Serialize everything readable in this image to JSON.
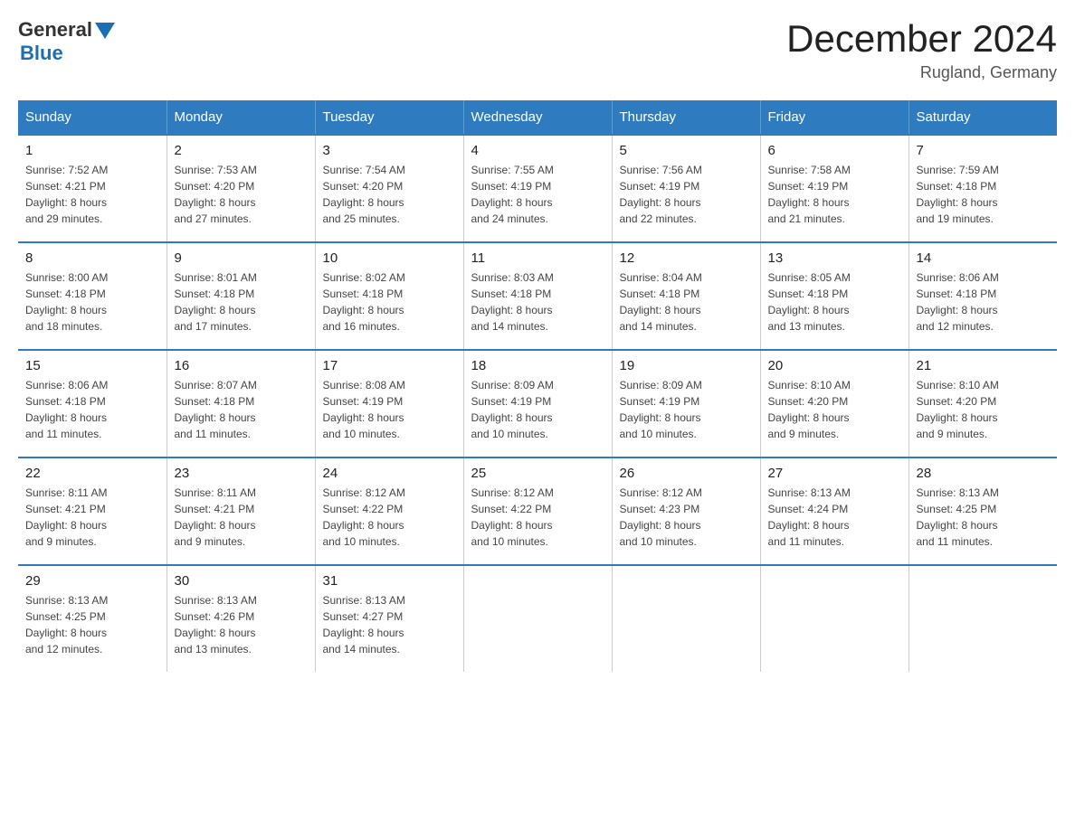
{
  "logo": {
    "general": "General",
    "blue": "Blue"
  },
  "title": "December 2024",
  "location": "Rugland, Germany",
  "days_of_week": [
    "Sunday",
    "Monday",
    "Tuesday",
    "Wednesday",
    "Thursday",
    "Friday",
    "Saturday"
  ],
  "weeks": [
    [
      {
        "day": "1",
        "sunrise": "7:52 AM",
        "sunset": "4:21 PM",
        "daylight": "8 hours and 29 minutes."
      },
      {
        "day": "2",
        "sunrise": "7:53 AM",
        "sunset": "4:20 PM",
        "daylight": "8 hours and 27 minutes."
      },
      {
        "day": "3",
        "sunrise": "7:54 AM",
        "sunset": "4:20 PM",
        "daylight": "8 hours and 25 minutes."
      },
      {
        "day": "4",
        "sunrise": "7:55 AM",
        "sunset": "4:19 PM",
        "daylight": "8 hours and 24 minutes."
      },
      {
        "day": "5",
        "sunrise": "7:56 AM",
        "sunset": "4:19 PM",
        "daylight": "8 hours and 22 minutes."
      },
      {
        "day": "6",
        "sunrise": "7:58 AM",
        "sunset": "4:19 PM",
        "daylight": "8 hours and 21 minutes."
      },
      {
        "day": "7",
        "sunrise": "7:59 AM",
        "sunset": "4:18 PM",
        "daylight": "8 hours and 19 minutes."
      }
    ],
    [
      {
        "day": "8",
        "sunrise": "8:00 AM",
        "sunset": "4:18 PM",
        "daylight": "8 hours and 18 minutes."
      },
      {
        "day": "9",
        "sunrise": "8:01 AM",
        "sunset": "4:18 PM",
        "daylight": "8 hours and 17 minutes."
      },
      {
        "day": "10",
        "sunrise": "8:02 AM",
        "sunset": "4:18 PM",
        "daylight": "8 hours and 16 minutes."
      },
      {
        "day": "11",
        "sunrise": "8:03 AM",
        "sunset": "4:18 PM",
        "daylight": "8 hours and 14 minutes."
      },
      {
        "day": "12",
        "sunrise": "8:04 AM",
        "sunset": "4:18 PM",
        "daylight": "8 hours and 14 minutes."
      },
      {
        "day": "13",
        "sunrise": "8:05 AM",
        "sunset": "4:18 PM",
        "daylight": "8 hours and 13 minutes."
      },
      {
        "day": "14",
        "sunrise": "8:06 AM",
        "sunset": "4:18 PM",
        "daylight": "8 hours and 12 minutes."
      }
    ],
    [
      {
        "day": "15",
        "sunrise": "8:06 AM",
        "sunset": "4:18 PM",
        "daylight": "8 hours and 11 minutes."
      },
      {
        "day": "16",
        "sunrise": "8:07 AM",
        "sunset": "4:18 PM",
        "daylight": "8 hours and 11 minutes."
      },
      {
        "day": "17",
        "sunrise": "8:08 AM",
        "sunset": "4:19 PM",
        "daylight": "8 hours and 10 minutes."
      },
      {
        "day": "18",
        "sunrise": "8:09 AM",
        "sunset": "4:19 PM",
        "daylight": "8 hours and 10 minutes."
      },
      {
        "day": "19",
        "sunrise": "8:09 AM",
        "sunset": "4:19 PM",
        "daylight": "8 hours and 10 minutes."
      },
      {
        "day": "20",
        "sunrise": "8:10 AM",
        "sunset": "4:20 PM",
        "daylight": "8 hours and 9 minutes."
      },
      {
        "day": "21",
        "sunrise": "8:10 AM",
        "sunset": "4:20 PM",
        "daylight": "8 hours and 9 minutes."
      }
    ],
    [
      {
        "day": "22",
        "sunrise": "8:11 AM",
        "sunset": "4:21 PM",
        "daylight": "8 hours and 9 minutes."
      },
      {
        "day": "23",
        "sunrise": "8:11 AM",
        "sunset": "4:21 PM",
        "daylight": "8 hours and 9 minutes."
      },
      {
        "day": "24",
        "sunrise": "8:12 AM",
        "sunset": "4:22 PM",
        "daylight": "8 hours and 10 minutes."
      },
      {
        "day": "25",
        "sunrise": "8:12 AM",
        "sunset": "4:22 PM",
        "daylight": "8 hours and 10 minutes."
      },
      {
        "day": "26",
        "sunrise": "8:12 AM",
        "sunset": "4:23 PM",
        "daylight": "8 hours and 10 minutes."
      },
      {
        "day": "27",
        "sunrise": "8:13 AM",
        "sunset": "4:24 PM",
        "daylight": "8 hours and 11 minutes."
      },
      {
        "day": "28",
        "sunrise": "8:13 AM",
        "sunset": "4:25 PM",
        "daylight": "8 hours and 11 minutes."
      }
    ],
    [
      {
        "day": "29",
        "sunrise": "8:13 AM",
        "sunset": "4:25 PM",
        "daylight": "8 hours and 12 minutes."
      },
      {
        "day": "30",
        "sunrise": "8:13 AM",
        "sunset": "4:26 PM",
        "daylight": "8 hours and 13 minutes."
      },
      {
        "day": "31",
        "sunrise": "8:13 AM",
        "sunset": "4:27 PM",
        "daylight": "8 hours and 14 minutes."
      },
      null,
      null,
      null,
      null
    ]
  ],
  "labels": {
    "sunrise_prefix": "Sunrise: ",
    "sunset_prefix": "Sunset: ",
    "daylight_prefix": "Daylight: "
  }
}
